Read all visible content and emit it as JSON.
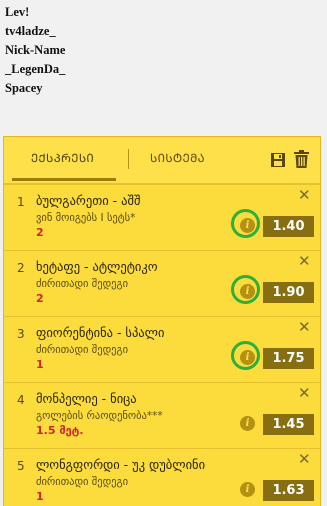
{
  "usernames": [
    "Lev!",
    "tv4ladze_",
    "Nick-Name",
    "_LegenDa_",
    "Spacey"
  ],
  "betslip": {
    "tabs": [
      {
        "label": "ᲔᲥᲡᲞᲠᲔᲡᲘ",
        "active": true
      },
      {
        "label": "ᲡᲘᲡᲢᲔᲛᲐ",
        "active": false
      }
    ],
    "icons": {
      "save": "save-icon",
      "delete": "trash-icon",
      "close": "close-icon",
      "info": "info-icon"
    },
    "colors": {
      "panel": "#fbdc3c",
      "odds_bg": "#876e10",
      "pick": "#d2232a",
      "highlight": "#2fae3a"
    },
    "items": [
      {
        "num": "1",
        "title": "ბულგარეთი - აშშ",
        "market": "ვინ მოიგებს I სეტს*",
        "pick": "2",
        "odds": "1.40",
        "highlighted": true
      },
      {
        "num": "2",
        "title": "ხეტაფე - ატლეტიკო",
        "market": "ძირითადი შედეგი",
        "pick": "2",
        "odds": "1.90",
        "highlighted": true
      },
      {
        "num": "3",
        "title": "ფიორენტინა - სპალი",
        "market": "ძირითადი შედეგი",
        "pick": "1",
        "odds": "1.75",
        "highlighted": true
      },
      {
        "num": "4",
        "title": "მონპელიე - ნიცა",
        "market": "გოლების რაოდენობა***",
        "pick": "1.5 მეტ.",
        "odds": "1.45",
        "highlighted": false
      },
      {
        "num": "5",
        "title": "ლონგფორდი - უკ დუბლინი",
        "market": "ძირითადი შედეგი",
        "pick": "1",
        "odds": "1.63",
        "highlighted": false
      }
    ]
  }
}
